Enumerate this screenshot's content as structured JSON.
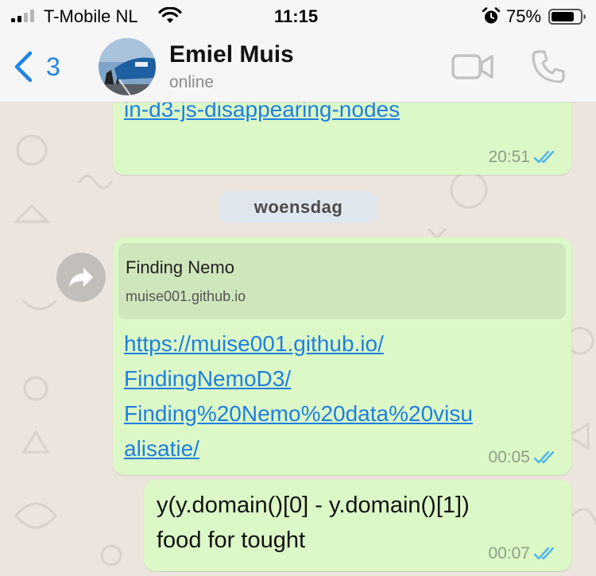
{
  "status_bar": {
    "carrier": "T-Mobile NL",
    "time": "11:15",
    "battery_percent": "75%"
  },
  "header": {
    "back_count": "3",
    "contact_name": "Emiel Muis",
    "contact_status": "online"
  },
  "messages": [
    {
      "type": "link",
      "lines": [
        "in-d3-js-disappearing-nodes"
      ],
      "time": "20:51",
      "read": true
    },
    {
      "type": "link_preview",
      "preview_title": "Finding Nemo",
      "preview_domain": "muise001.github.io",
      "lines": [
        "https://muise001.github.io/",
        "FindingNemoD3/",
        "Finding%20Nemo%20data%20visu",
        "alisatie/"
      ],
      "time": "00:05",
      "read": true
    },
    {
      "type": "text",
      "lines": [
        "y(y.domain()[0] - y.domain()[1])",
        "food for tought"
      ],
      "time": "00:07",
      "read": true
    }
  ],
  "date_separator": "woensdag",
  "colors": {
    "accent": "#1e84e6",
    "outgoing_bubble": "#dcf8c6",
    "link": "#1f7fe0",
    "read_ticks": "#4fb4e8"
  },
  "icons": [
    "signal-icon",
    "wifi-icon",
    "alarm-icon",
    "battery-icon",
    "back-chevron-icon",
    "video-call-icon",
    "phone-call-icon",
    "forward-icon",
    "double-check-icon"
  ]
}
